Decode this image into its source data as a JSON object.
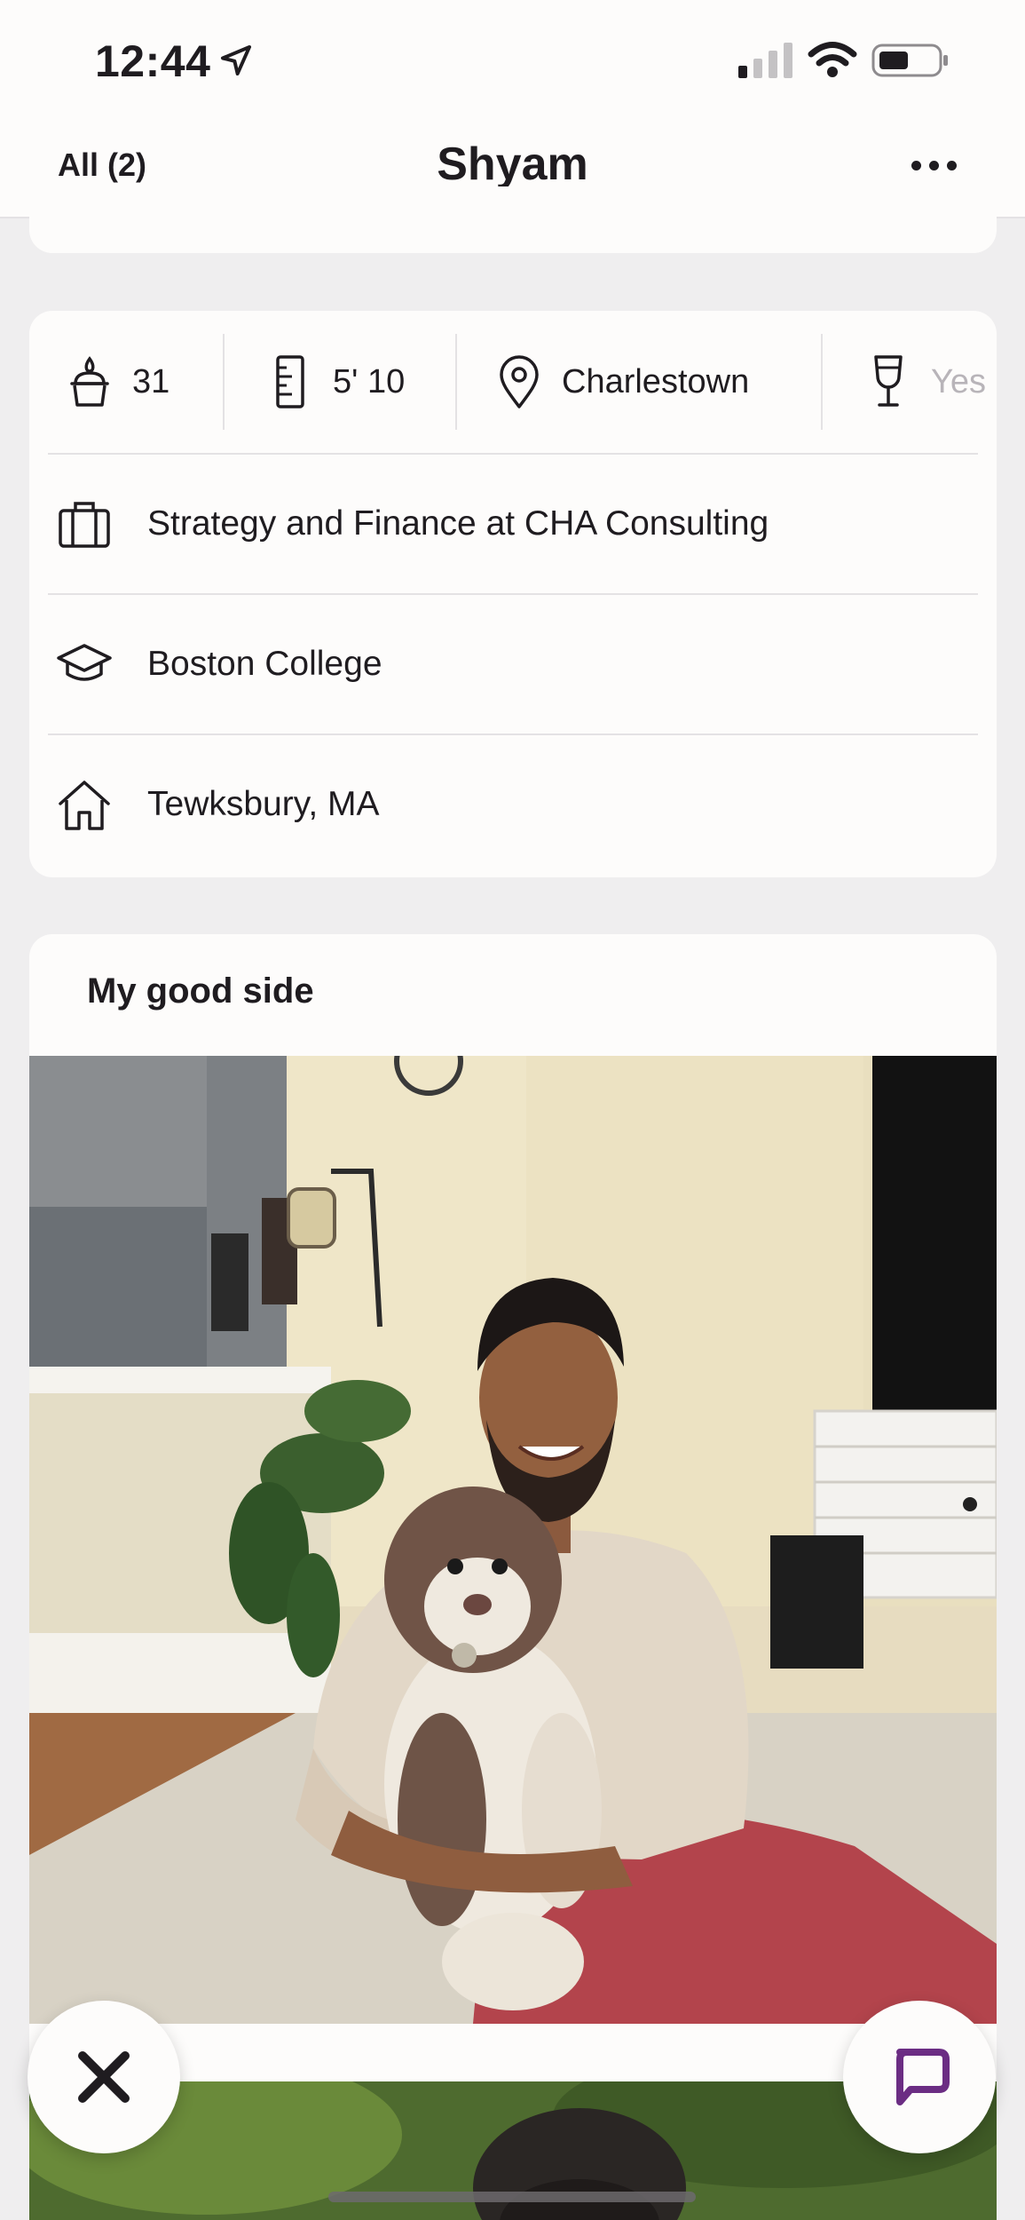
{
  "status_bar": {
    "time": "12:44"
  },
  "nav": {
    "back_label": "All (2)",
    "title": "Shyam"
  },
  "vitals": {
    "age": "31",
    "height": "5' 10",
    "location": "Charlestown",
    "drinking": "Yes"
  },
  "info_rows": {
    "job": "Strategy and Finance at CHA Consulting",
    "school": "Boston College",
    "hometown": "Tewksbury, MA"
  },
  "photo_prompt": {
    "label": "My good side"
  },
  "icons": {
    "age": "cake-icon",
    "height": "ruler-icon",
    "location": "map-pin-icon",
    "drinking": "wine-glass-icon",
    "job": "briefcase-icon",
    "school": "graduation-cap-icon",
    "hometown": "house-icon",
    "pass": "close-x-icon",
    "comment": "chat-bubble-icon"
  },
  "colors": {
    "accent": "#6b2d83",
    "background": "#efeeef",
    "card": "#fdfcfb"
  }
}
